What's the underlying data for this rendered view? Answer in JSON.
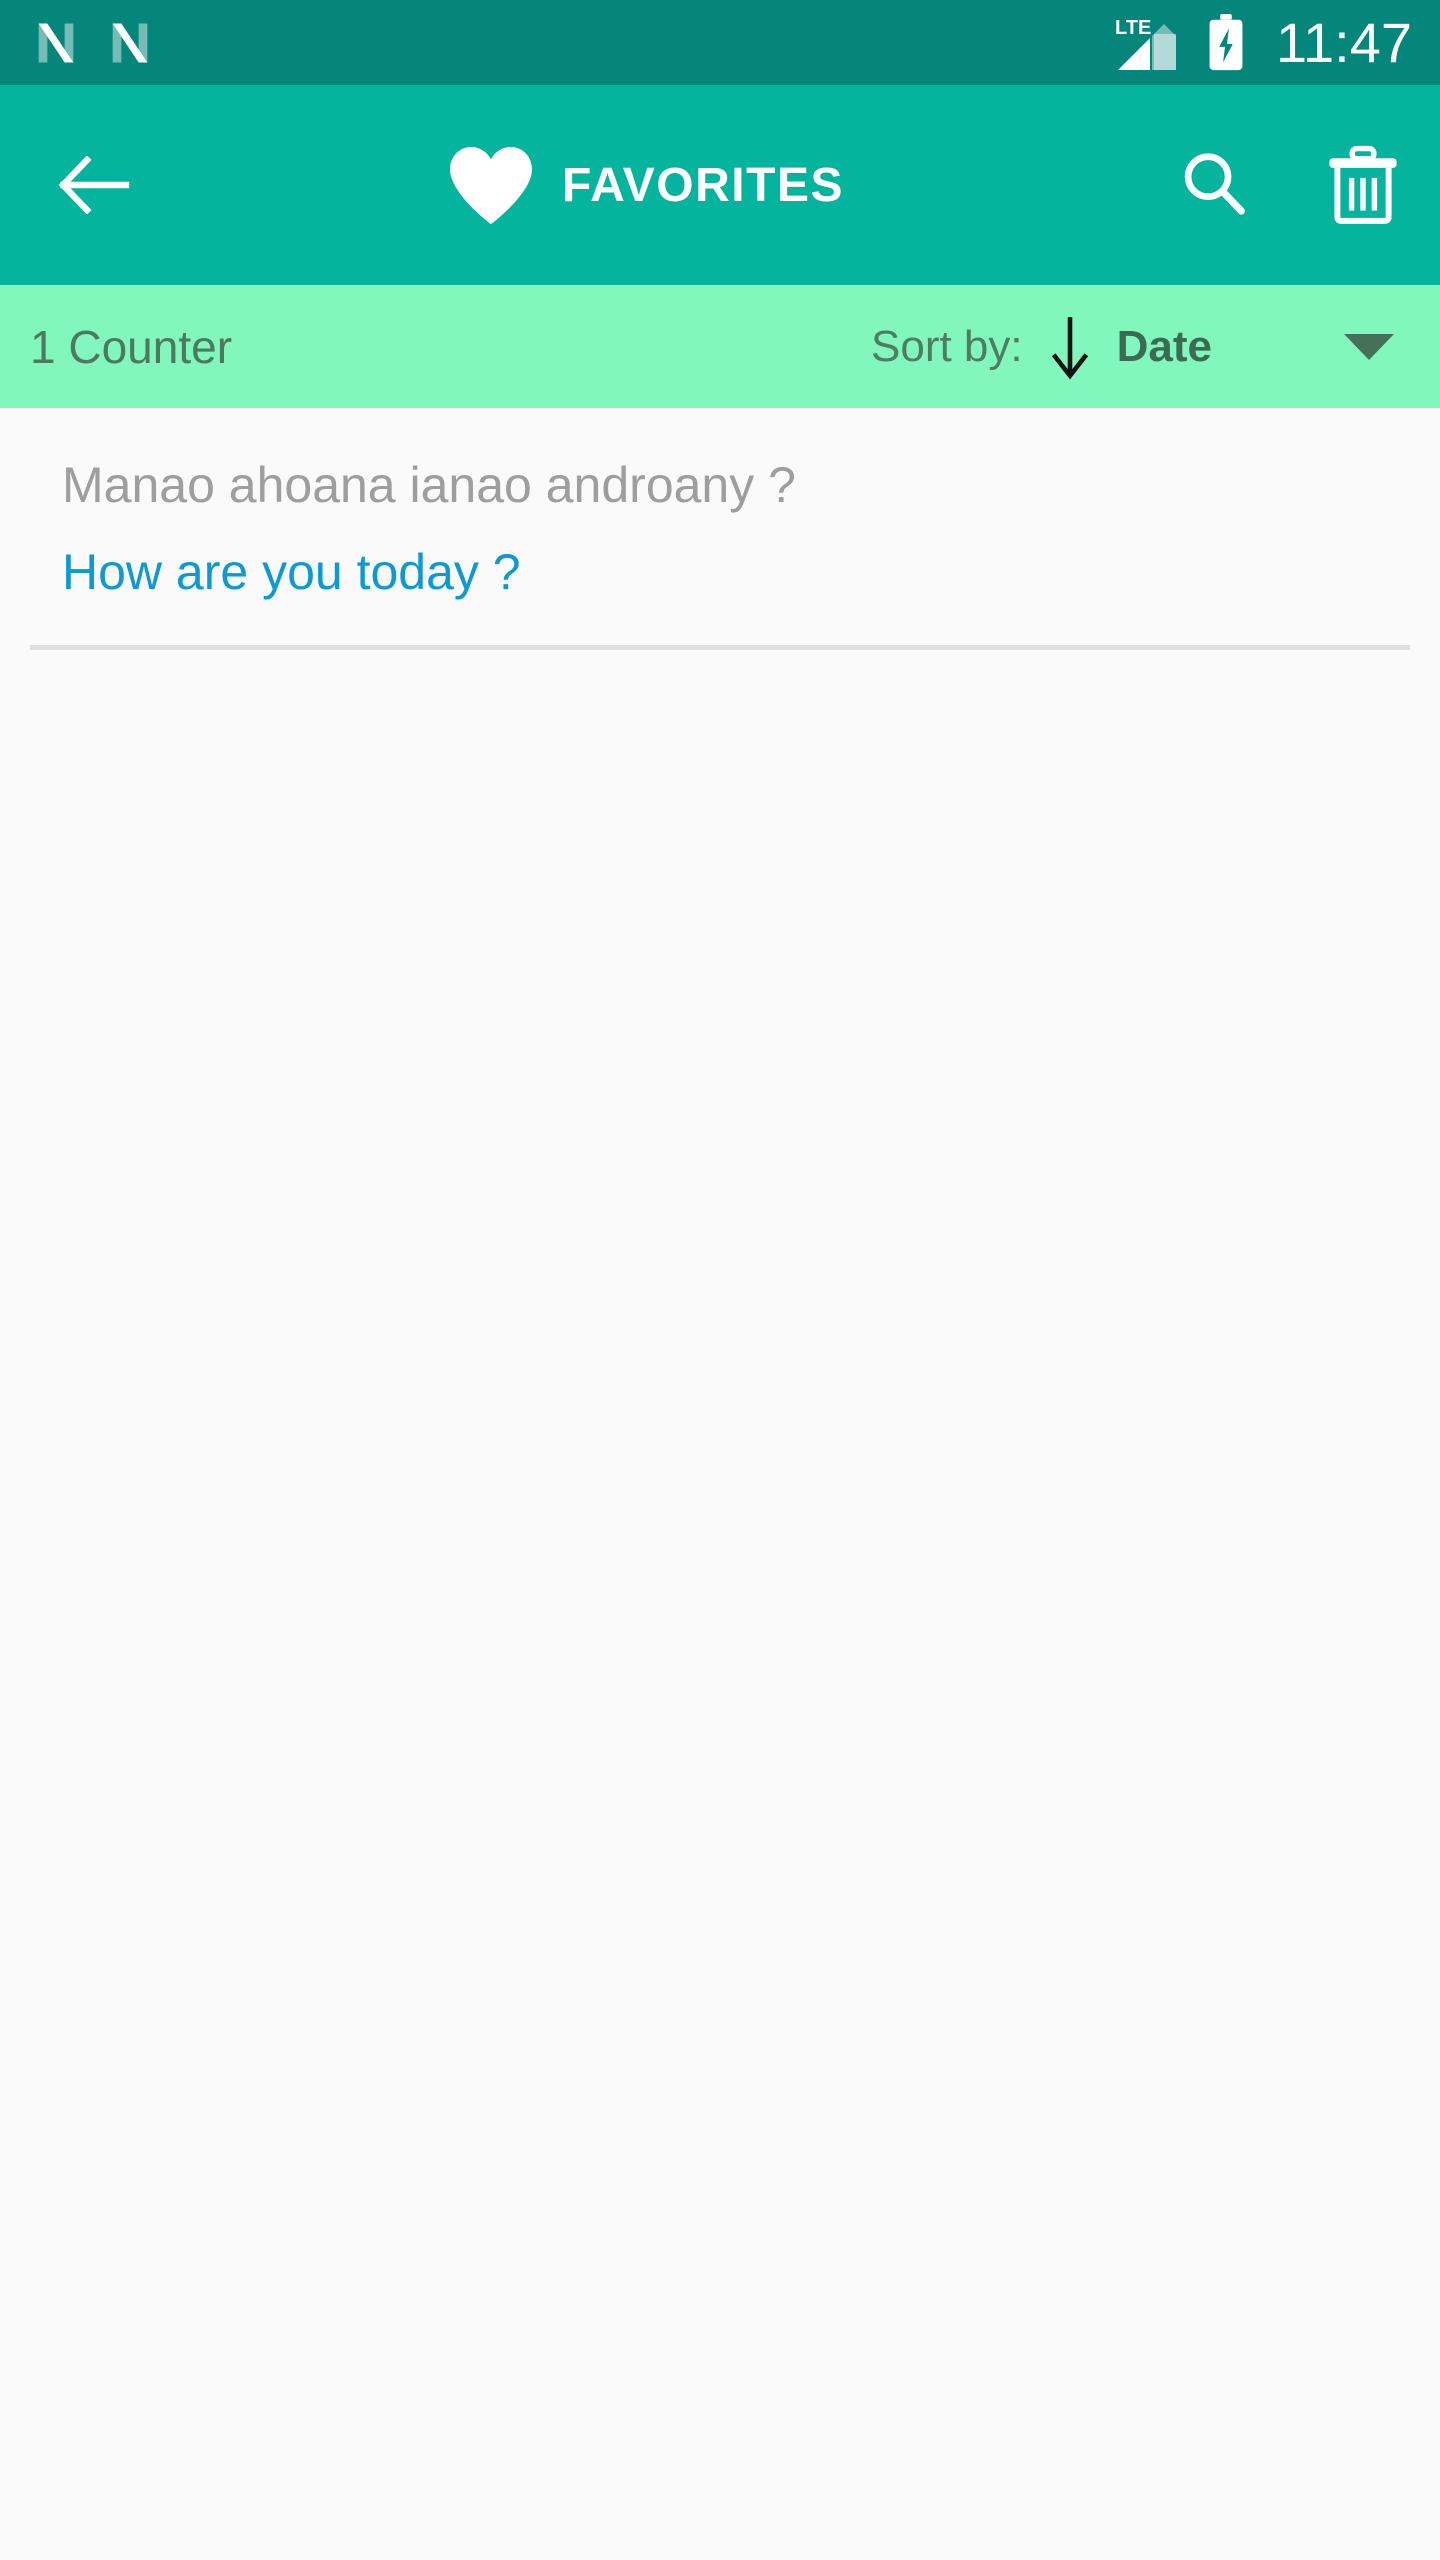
{
  "status_bar": {
    "notification_icons": [
      "app-notification-n-icon",
      "app-notification-n-icon"
    ],
    "network_label": "LTE",
    "battery_state": "charging",
    "time": "11:47",
    "background_color": "#04867a"
  },
  "app_bar": {
    "back_label": "back-arrow",
    "brand_icon": "heart-icon",
    "title": "FAVORITES",
    "actions": [
      {
        "name": "search-icon",
        "label": "Search"
      },
      {
        "name": "trash-icon",
        "label": "Delete"
      }
    ],
    "background_color": "#05b49c"
  },
  "sort_bar": {
    "counter_text": "1 Counter",
    "sort_by_label": "Sort by:",
    "sort_direction_icon": "arrow-down-icon",
    "sort_value": "Date",
    "dropdown_icon": "chevron-down-icon",
    "background_color": "#82f7bd"
  },
  "list": {
    "items": [
      {
        "source_text": "Manao ahoana ianao androany ?",
        "target_text": "How are you today ?"
      }
    ]
  },
  "colors": {
    "accent": "#05b49c",
    "status": "#04867a",
    "mint": "#82f7bd",
    "translation_blue": "#0d9ad4",
    "source_gray": "#9e9e9e",
    "page_background": "#fafafa"
  }
}
